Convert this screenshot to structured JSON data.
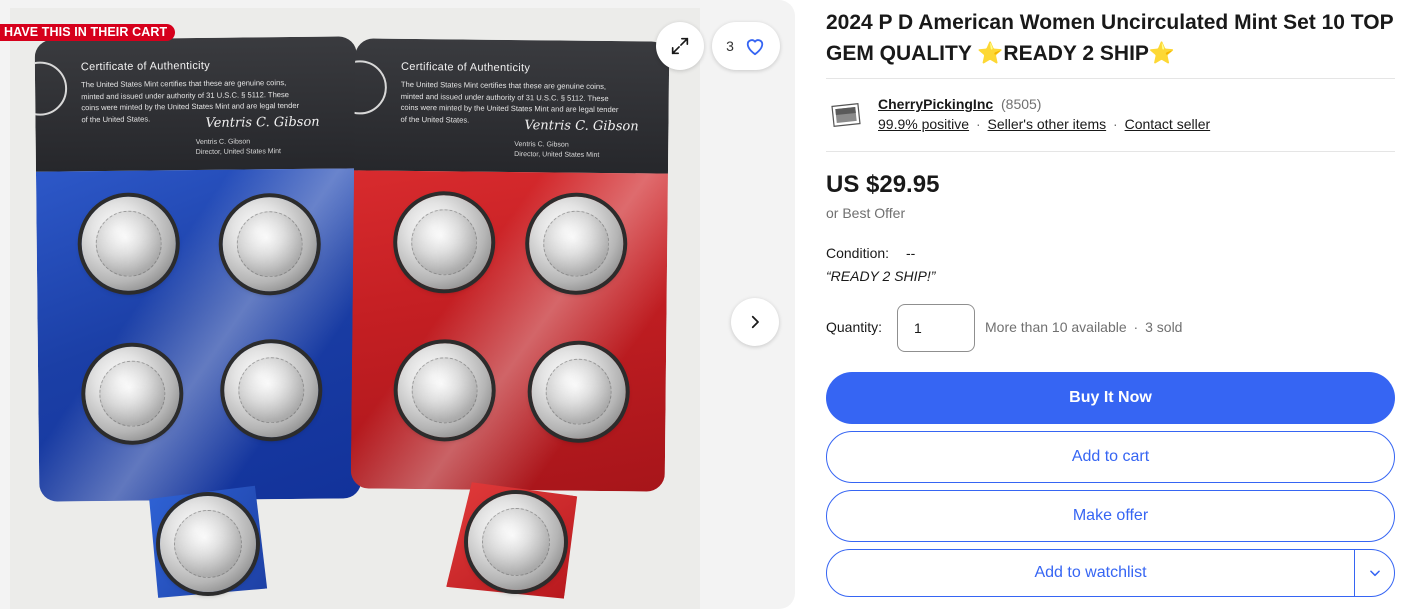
{
  "gallery": {
    "badge": "HAVE THIS IN THEIR CART",
    "watch_count": "3",
    "icons": {
      "expand": "expand-icon",
      "heart": "heart-icon",
      "next": "chevron-right-icon"
    },
    "cards": [
      {
        "color": "#1b3fa6",
        "cert_title": "Certificate of Authenticity",
        "cert_body": "The United States Mint certifies that these are genuine coins, minted and issued under authority of 31 U.S.C. § 5112. These coins were minted by the United States Mint and are legal tender of the United States.",
        "signature": "Ventris C. Gibson",
        "signer_name": "Ventris C. Gibson",
        "signer_title": "Director, United States Mint"
      },
      {
        "color": "#c41f23",
        "cert_title": "Certificate of Authenticity",
        "cert_body": "The United States Mint certifies that these are genuine coins, minted and issued under authority of 31 U.S.C. § 5112. These coins were minted by the United States Mint and are legal tender of the United States.",
        "signature": "Ventris C. Gibson",
        "signer_name": "Ventris C. Gibson",
        "signer_title": "Director, United States Mint"
      }
    ]
  },
  "listing": {
    "title": "2024 P D American Women Uncirculated Mint Set 10 TOP GEM QUALITY ⭐READY 2 SHIP⭐"
  },
  "seller": {
    "name": "CherryPickingInc",
    "feedback_count": "(8505)",
    "positive": "99.9% positive",
    "other_items": "Seller's other items",
    "contact": "Contact seller",
    "separator": "·"
  },
  "price": {
    "amount": "US $29.95",
    "best_offer": "or Best Offer"
  },
  "condition": {
    "label": "Condition:",
    "value": "--",
    "note": "“READY 2 SHIP!”"
  },
  "quantity": {
    "label": "Quantity:",
    "value": "1",
    "available": "More than 10 available",
    "sold": "3 sold",
    "separator": "·"
  },
  "actions": {
    "buy_now": "Buy It Now",
    "add_to_cart": "Add to cart",
    "make_offer": "Make offer",
    "add_to_watchlist": "Add to watchlist"
  },
  "colors": {
    "accent": "#3665f3",
    "badge_red": "#d6001c",
    "text": "#191919",
    "muted": "#707070"
  }
}
